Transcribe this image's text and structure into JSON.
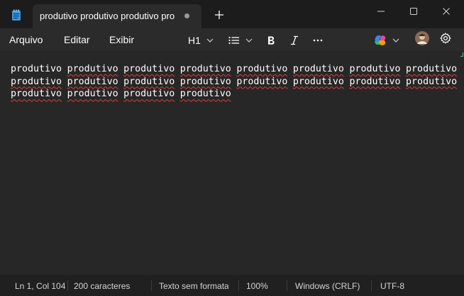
{
  "tab": {
    "title": "produtivo produtivo produtivo pro"
  },
  "menu": {
    "file": "Arquivo",
    "edit": "Editar",
    "view": "Exibir"
  },
  "toolbar": {
    "heading": "H1"
  },
  "editor": {
    "first_word": "produtivo",
    "rest_words": [
      "produtivo",
      "produtivo",
      "produtivo",
      "produtivo",
      "produtivo",
      "produtivo",
      "produtivo",
      "produtivo",
      "produtivo",
      "produtivo",
      "produtivo",
      "produtivo",
      "produtivo",
      "produtivo",
      "produtivo",
      "produtivo",
      "produtivo",
      "produtivo",
      "produtivo"
    ]
  },
  "status": {
    "position": "Ln 1, Col 104",
    "chars": "200 caracteres",
    "format": "Texto sem formatação",
    "zoom": "100%",
    "line_ending": "Windows (CRLF)",
    "encoding": "UTF-8"
  },
  "colors": {
    "accent_underline": "#e03a3a",
    "tab_bg": "#2b2b2b",
    "editor_bg": "#272727"
  },
  "icons": [
    "notepad-icon",
    "tab-modified-dot-icon",
    "plus-icon",
    "minimize-icon",
    "maximize-icon",
    "close-icon",
    "list-icon",
    "bold-icon",
    "italic-icon",
    "more-icon",
    "copilot-icon",
    "avatar",
    "gear-icon"
  ]
}
